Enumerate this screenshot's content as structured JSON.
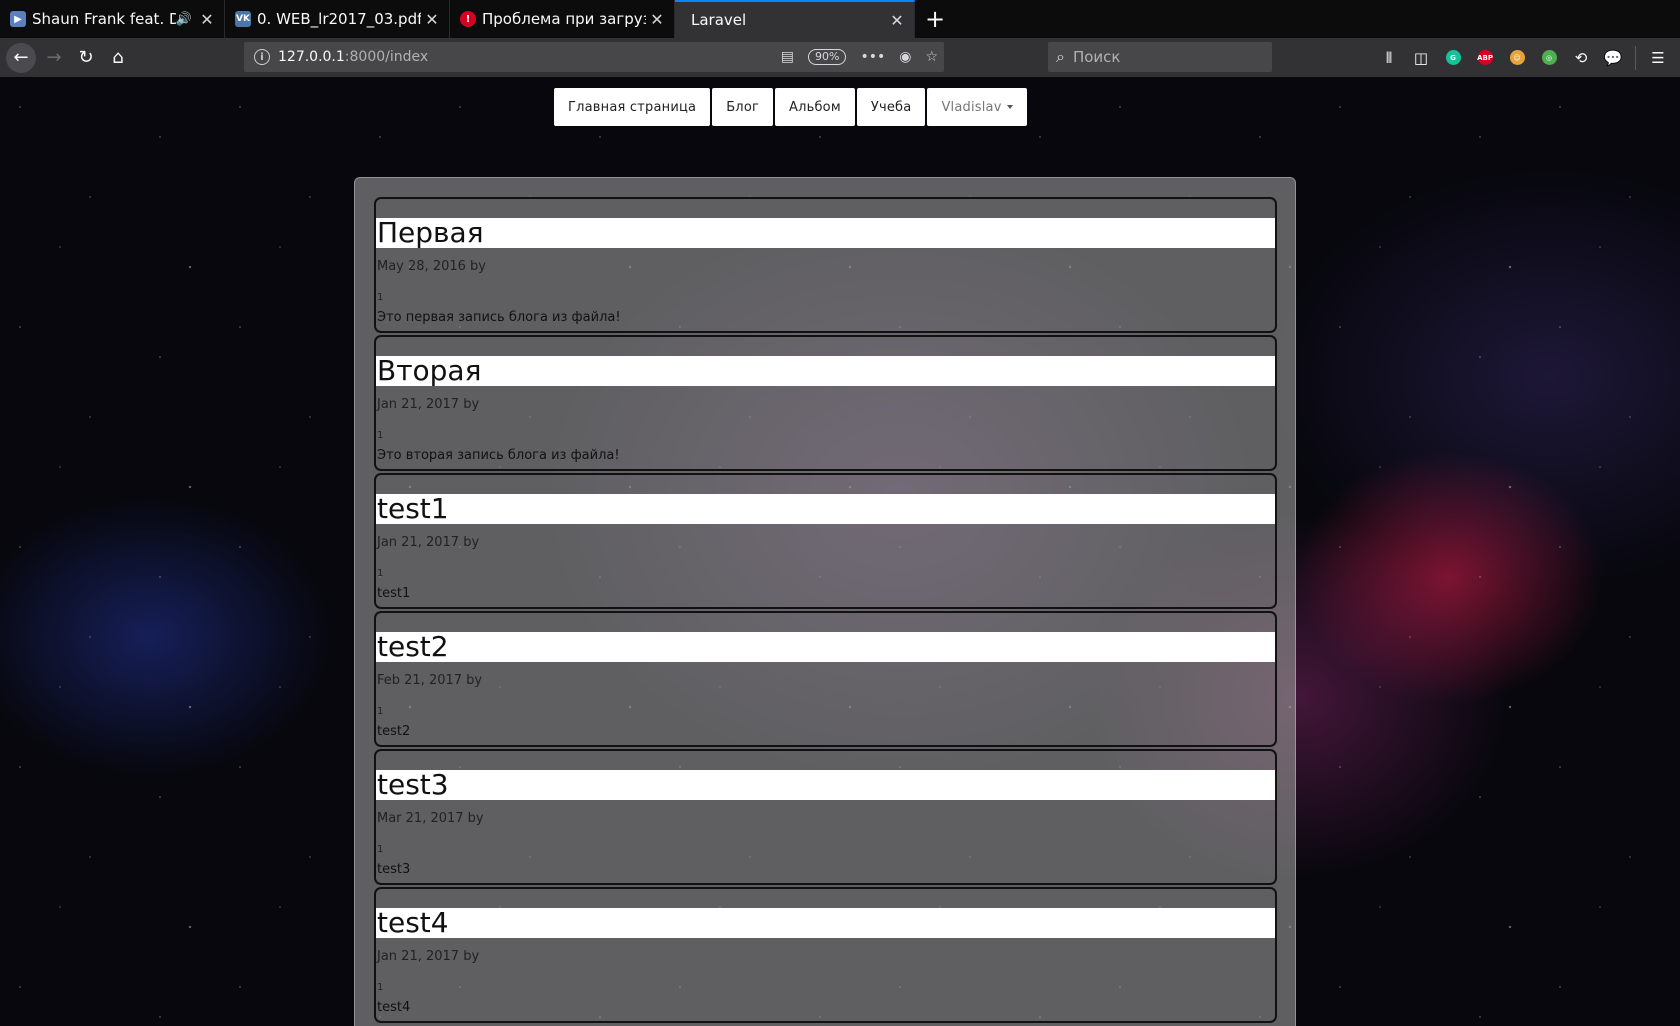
{
  "browser": {
    "tabs": [
      {
        "title": "Shaun Frank feat. DYSON",
        "favicon": "play-icon",
        "audio": true
      },
      {
        "title": "0. WEB_lr2017_03.pdf",
        "favicon": "vk-icon"
      },
      {
        "title": "Проблема при загрузке страницы",
        "favicon": "warning-icon"
      },
      {
        "title": "Laravel",
        "favicon": "",
        "active": true
      }
    ],
    "url_host": "127.0.0.1",
    "url_path": ":8000/index",
    "zoom": "90%",
    "search_placeholder": "Поиск",
    "vk_glyph": "VK",
    "abp_glyph": "ABP"
  },
  "nav": {
    "items": [
      "Главная страница",
      "Блог",
      "Альбом",
      "Учеба"
    ],
    "user": "Vladislav"
  },
  "posts": [
    {
      "title": "Первая",
      "date": "May 28, 2016 by",
      "num": "1",
      "body": "Это первая запись блога из файла!"
    },
    {
      "title": "Вторая",
      "date": "Jan 21, 2017 by",
      "num": "1",
      "body": "Это вторая запись блога из файла!"
    },
    {
      "title": "test1",
      "date": "Jan 21, 2017 by",
      "num": "1",
      "body": "test1"
    },
    {
      "title": "test2",
      "date": "Feb 21, 2017 by",
      "num": "1",
      "body": "test2"
    },
    {
      "title": "test3",
      "date": "Mar 21, 2017 by",
      "num": "1",
      "body": "test3"
    },
    {
      "title": "test4",
      "date": "Jan 21, 2017 by",
      "num": "1",
      "body": "test4"
    }
  ]
}
